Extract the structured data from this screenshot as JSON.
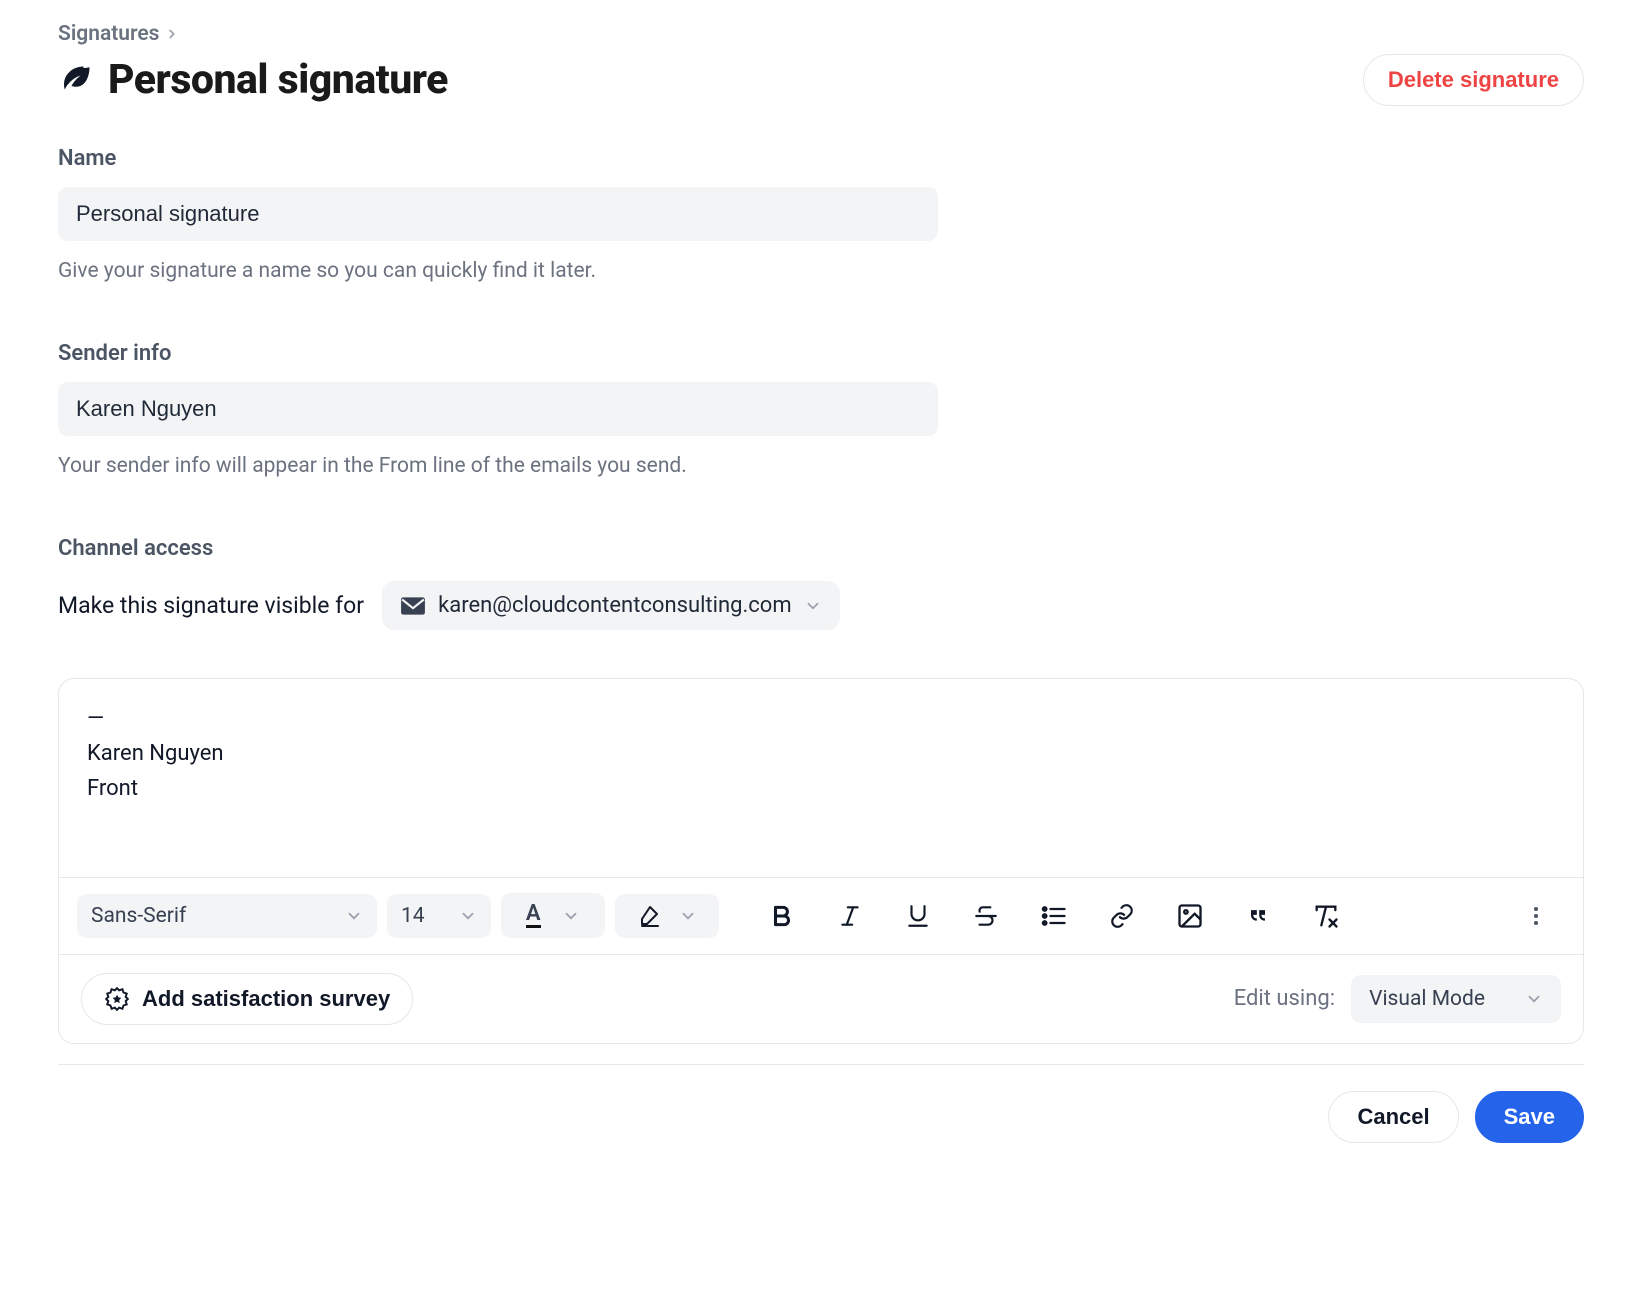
{
  "breadcrumb": {
    "parent": "Signatures"
  },
  "header": {
    "title": "Personal signature",
    "delete_label": "Delete signature"
  },
  "name_section": {
    "label": "Name",
    "value": "Personal signature",
    "help": "Give your signature a name so you can quickly find it later."
  },
  "sender_section": {
    "label": "Sender info",
    "value": "Karen Nguyen",
    "help": "Your sender info will appear in the From line of the emails you send."
  },
  "channel_section": {
    "label": "Channel access",
    "prompt": "Make this signature visible for",
    "selected_channel": "karen@cloudcontentconsulting.com"
  },
  "editor": {
    "lines": [
      "—",
      "Karen Nguyen",
      "Front"
    ],
    "toolbar": {
      "font_family": "Sans-Serif",
      "font_size": "14"
    },
    "survey_label": "Add satisfaction survey",
    "mode_label": "Edit using:",
    "mode_value": "Visual Mode"
  },
  "actions": {
    "cancel": "Cancel",
    "save": "Save"
  }
}
